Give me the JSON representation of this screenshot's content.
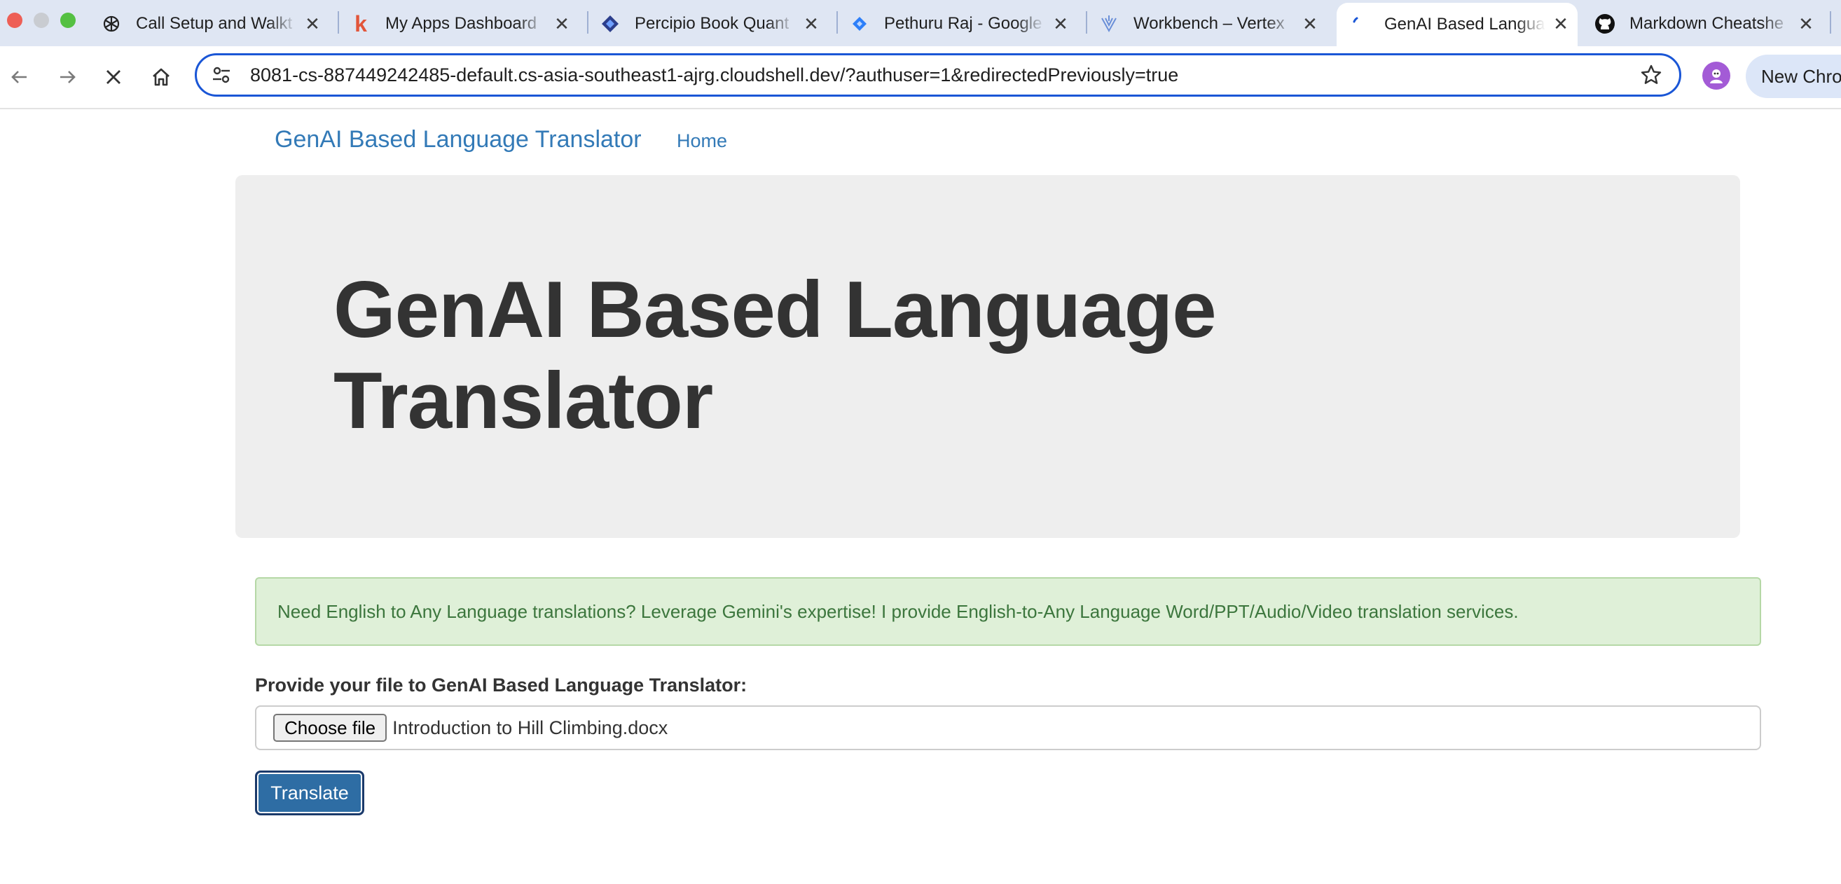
{
  "browser": {
    "tabs": [
      {
        "title": "Call Setup and Walkt",
        "icon": "openai-icon"
      },
      {
        "title": "My Apps Dashboard",
        "icon": "k-logo-icon"
      },
      {
        "title": "Percipio Book Quant",
        "icon": "percipio-icon"
      },
      {
        "title": "Pethuru Raj - Google",
        "icon": "jira-icon"
      },
      {
        "title": "Workbench – Vertex",
        "icon": "vertex-icon"
      },
      {
        "title": "GenAI Based Langua",
        "icon": "loading-icon",
        "active": true
      },
      {
        "title": "Markdown Cheatshe",
        "icon": "github-icon"
      }
    ],
    "url": "8081-cs-887449242485-default.cs-asia-southeast1-ajrg.cloudshell.dev/?authuser=1&redirectedPreviously=true",
    "new_chrome_label": "New Chro",
    "colors": {
      "omnibox_border": "#1a56d6",
      "tabstrip_bg": "#dfe6f3"
    }
  },
  "page": {
    "navbar": {
      "brand": "GenAI Based Language Translator",
      "home": "Home"
    },
    "jumbotron": {
      "title": "GenAI Based Language Translator"
    },
    "alert": {
      "text": "Need English to Any Language translations? Leverage Gemini's expertise! I provide English-to-Any Language Word/PPT/Audio/Video translation services."
    },
    "form": {
      "label": "Provide your file to GenAI Based Language Translator:",
      "choose_file": "Choose file",
      "file_name": "Introduction to Hill Climbing.docx",
      "submit": "Translate"
    },
    "colors": {
      "link": "#337ab7",
      "alert_bg": "#dff0d8",
      "alert_text": "#3c763d",
      "button": "#2e6da4"
    }
  }
}
